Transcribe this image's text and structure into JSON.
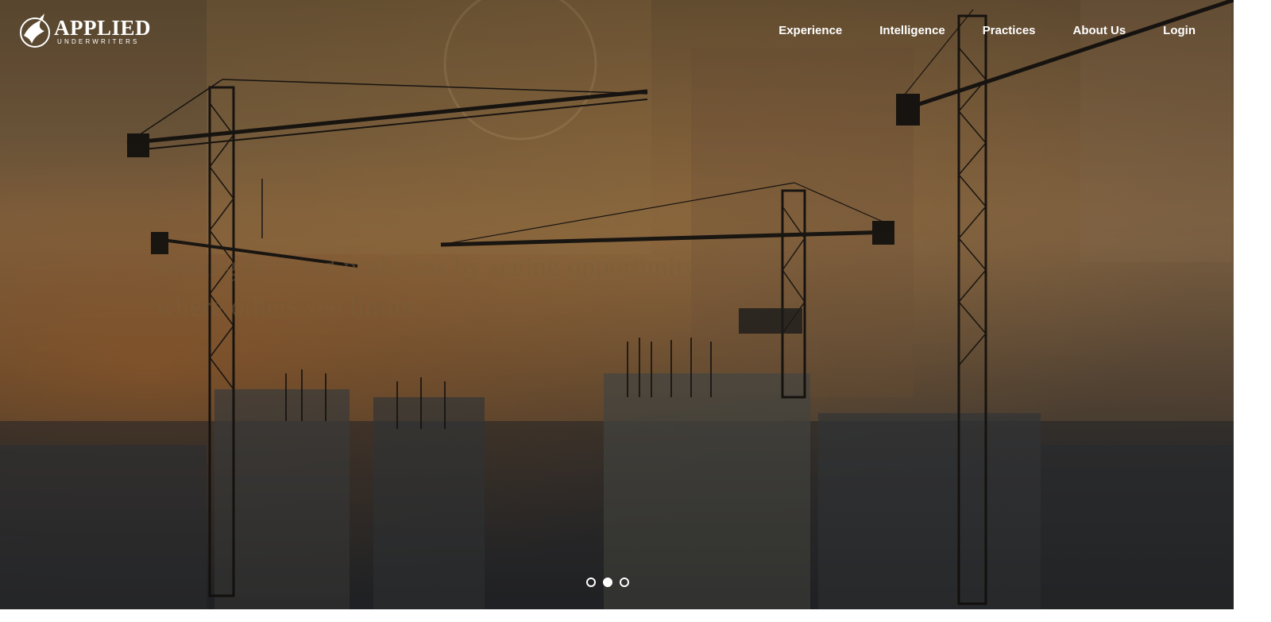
{
  "brand": {
    "name": "APPLIED",
    "subtitle": "UNDERWRITERS",
    "logo_icon": "eagle-emblem-icon"
  },
  "nav": {
    "items": [
      {
        "label": "Experience"
      },
      {
        "label": "Intelligence"
      },
      {
        "label": "Practices"
      },
      {
        "label": "About Us"
      },
      {
        "label": "Login"
      }
    ]
  },
  "hero": {
    "background": "construction cranes over a container port",
    "faded_caption": "solving fear and problems by seeing opportunity where others see limits"
  },
  "carousel": {
    "slide_count": 3,
    "active_index": 1
  },
  "colors": {
    "nav_text": "#ffffff",
    "overlay_tint": "#6b5538"
  }
}
